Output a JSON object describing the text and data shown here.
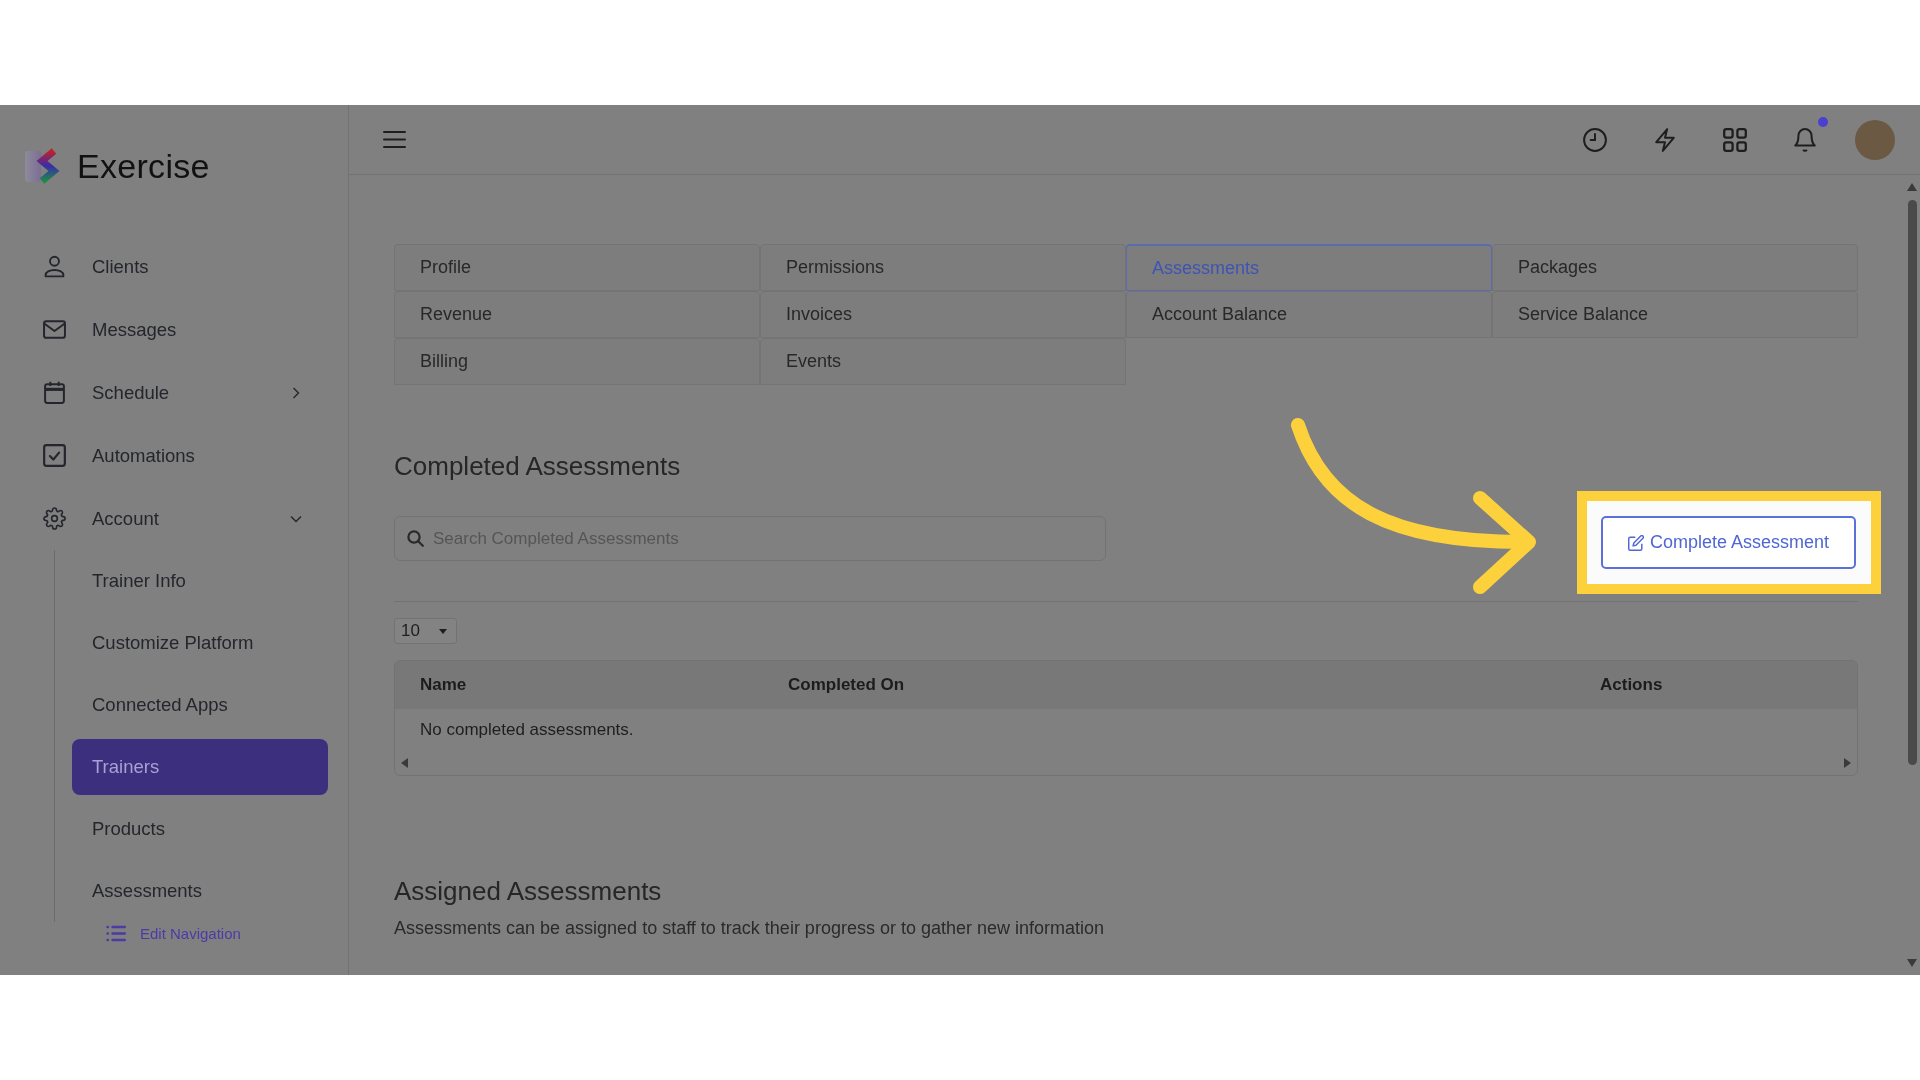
{
  "brand": {
    "name": "Exercise"
  },
  "sidebar": {
    "items": [
      {
        "label": "Clients",
        "kind": "link",
        "selected": false
      },
      {
        "label": "Messages",
        "kind": "link",
        "selected": false
      },
      {
        "label": "Schedule",
        "kind": "group",
        "expanded": false,
        "selected": false
      },
      {
        "label": "Automations",
        "kind": "link",
        "selected": false
      },
      {
        "label": "Account",
        "kind": "group",
        "expanded": true,
        "selected": false,
        "children": [
          {
            "label": "Trainer Info",
            "selected": false
          },
          {
            "label": "Customize Platform",
            "selected": false
          },
          {
            "label": "Connected Apps",
            "selected": false
          },
          {
            "label": "Trainers",
            "selected": true
          },
          {
            "label": "Products",
            "selected": false
          },
          {
            "label": "Assessments",
            "selected": false
          }
        ]
      }
    ],
    "edit_link": "Edit Navigation"
  },
  "topbar": {
    "notifications_unread": true
  },
  "tabs": [
    {
      "label": "Profile",
      "selected": false
    },
    {
      "label": "Permissions",
      "selected": false
    },
    {
      "label": "Assessments",
      "selected": true
    },
    {
      "label": "Packages",
      "selected": false
    },
    {
      "label": "Revenue",
      "selected": false
    },
    {
      "label": "Invoices",
      "selected": false
    },
    {
      "label": "Account Balance",
      "selected": false
    },
    {
      "label": "Service Balance",
      "selected": false
    },
    {
      "label": "Billing",
      "selected": false
    },
    {
      "label": "Events",
      "selected": false
    }
  ],
  "completed_assessments": {
    "title": "Completed Assessments",
    "search": {
      "placeholder": "Search Completed Assessments"
    },
    "action_button": {
      "label": "Complete Assessment",
      "highlighted": true
    },
    "page_size": "10",
    "table": {
      "columns": [
        "Name",
        "Completed On",
        "Actions"
      ],
      "empty_message": "No completed assessments."
    }
  },
  "assigned_assessments": {
    "title": "Assigned Assessments",
    "description": "Assessments can be assigned to staff to track their progress or to gather new information"
  }
}
